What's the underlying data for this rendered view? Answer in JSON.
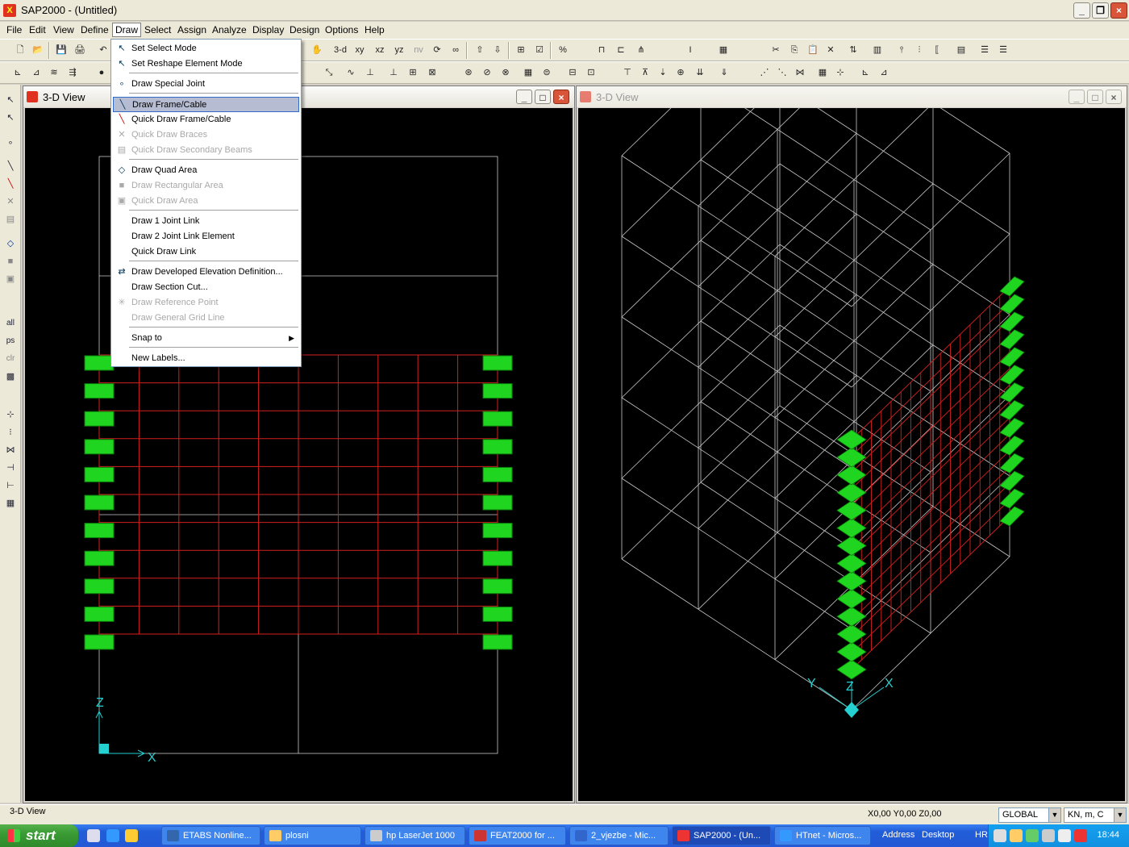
{
  "app": {
    "title": "SAP2000 - (Untitled)"
  },
  "menubar": [
    "File",
    "Edit",
    "View",
    "Define",
    "Draw",
    "Select",
    "Assign",
    "Analyze",
    "Display",
    "Design",
    "Options",
    "Help"
  ],
  "toolbar": {
    "btn_3d": "3-d",
    "btn_xy": "xy",
    "btn_xz": "xz",
    "btn_yz": "yz",
    "btn_nv": "nv"
  },
  "left_toolbar": {
    "all": "all",
    "ps": "ps",
    "clr": "clr"
  },
  "draw_menu": {
    "items": [
      {
        "label": "Set Select Mode",
        "disabled": false
      },
      {
        "label": "Set Reshape Element Mode",
        "disabled": false
      },
      {
        "label": "Draw Special Joint",
        "disabled": false
      },
      {
        "label": "Draw Frame/Cable",
        "disabled": false,
        "highlighted": true
      },
      {
        "label": "Quick Draw Frame/Cable",
        "disabled": false
      },
      {
        "label": "Quick Draw Braces",
        "disabled": true
      },
      {
        "label": "Quick Draw Secondary Beams",
        "disabled": true
      },
      {
        "label": "Draw Quad Area",
        "disabled": false
      },
      {
        "label": "Draw Rectangular Area",
        "disabled": true
      },
      {
        "label": "Quick Draw Area",
        "disabled": true
      },
      {
        "label": "Draw 1 Joint Link",
        "disabled": false
      },
      {
        "label": "Draw 2 Joint Link Element",
        "disabled": false
      },
      {
        "label": "Quick Draw Link",
        "disabled": false
      },
      {
        "label": "Draw Developed Elevation Definition...",
        "disabled": false
      },
      {
        "label": "Draw Section Cut...",
        "disabled": false
      },
      {
        "label": "Draw Reference Point",
        "disabled": true
      },
      {
        "label": "Draw General Grid Line",
        "disabled": true
      },
      {
        "label": "Snap to",
        "disabled": false,
        "submenu": true
      },
      {
        "label": "New Labels...",
        "disabled": false
      }
    ]
  },
  "left_view": {
    "title": "3-D View",
    "axis_z": "Z",
    "axis_x": "X"
  },
  "right_view": {
    "title": "3-D View",
    "axis_y": "Y",
    "axis_z": "Z",
    "axis_x": "X"
  },
  "status": {
    "text": "3-D View",
    "coords": "X0,00  Y0,00  Z0,00",
    "coord_system": "GLOBAL",
    "units": "KN, m, C"
  },
  "taskbar": {
    "start": "start",
    "tasks": [
      {
        "label": "ETABS Nonline...",
        "active": false
      },
      {
        "label": "plosni",
        "active": false
      },
      {
        "label": "hp LaserJet 1000",
        "active": false
      },
      {
        "label": "FEAT2000 for ...",
        "active": false
      },
      {
        "label": "2_vjezbe - Mic...",
        "active": false
      },
      {
        "label": "SAP2000 - (Un...",
        "active": true
      },
      {
        "label": "HTnet - Micros...",
        "active": false
      }
    ],
    "address": "Address",
    "desktop": "Desktop",
    "lang": "HR",
    "clock": "18:44"
  },
  "colors": {
    "grid_line": "#c8c8c8",
    "area_mesh": "#d42020",
    "support": "#1fd51f",
    "axis": "#25d0d0",
    "highlight": "#b6bdd2"
  }
}
